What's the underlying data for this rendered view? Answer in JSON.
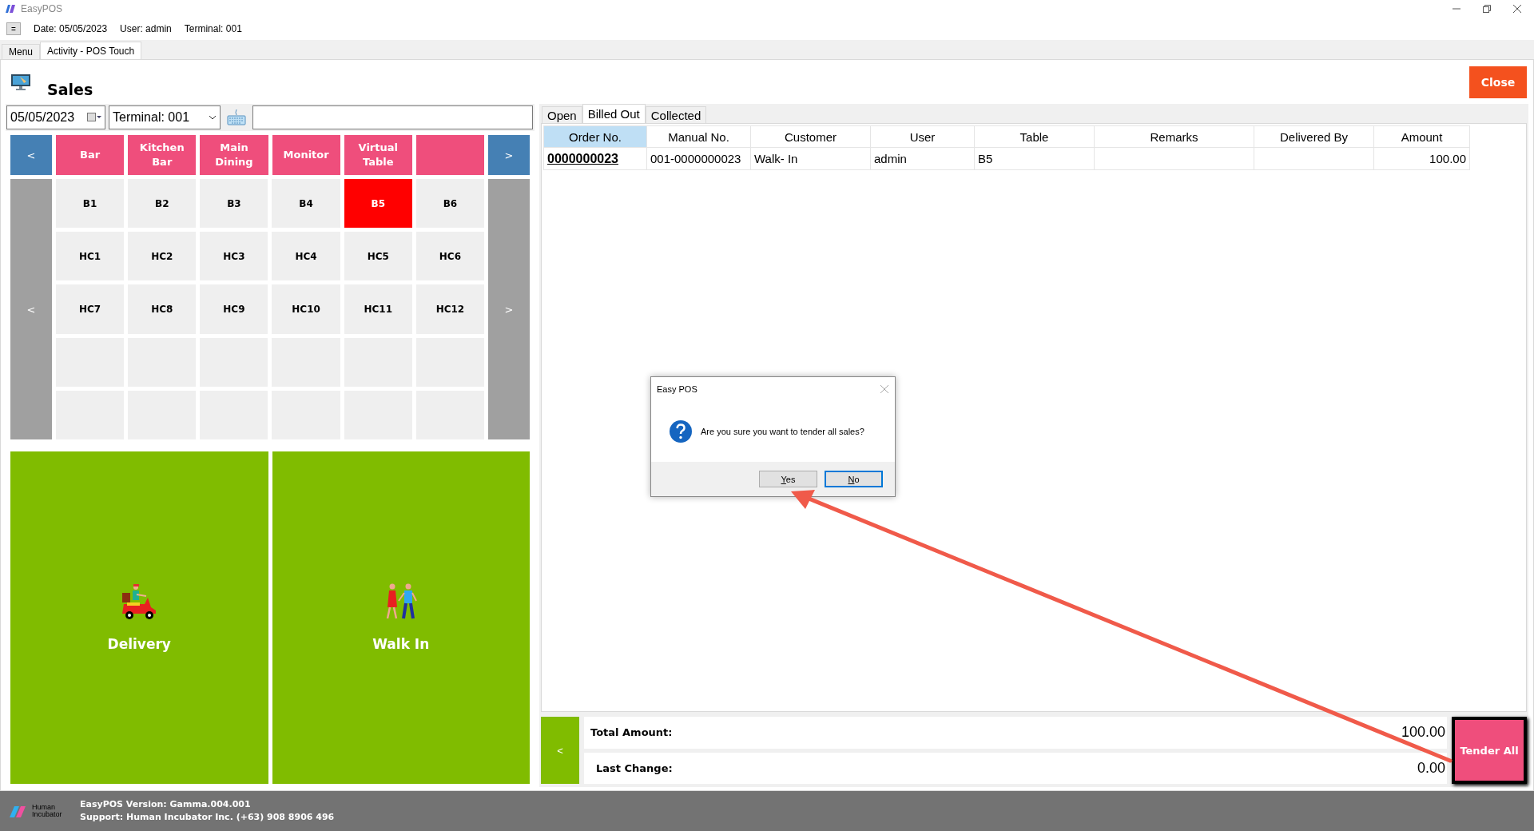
{
  "window": {
    "title": "EasyPOS"
  },
  "info_bar": {
    "menu_button": "=",
    "date": "Date: 05/05/2023",
    "user": "User: admin",
    "terminal": "Terminal: 001"
  },
  "tabs": [
    {
      "label": "Menu",
      "selected": false
    },
    {
      "label": "Activity - POS Touch",
      "selected": true
    }
  ],
  "page": {
    "title": "Sales",
    "close_button": "Close"
  },
  "filters": {
    "date": "05/05/2023",
    "terminal": "Terminal: 001"
  },
  "categories": {
    "prev": "<",
    "next": ">",
    "items": [
      {
        "kind": "category",
        "label": "Bar"
      },
      {
        "kind": "category",
        "label": "Kitchen Bar"
      },
      {
        "kind": "category",
        "label": "Main Dining"
      },
      {
        "kind": "category",
        "label": "Monitor"
      },
      {
        "kind": "category",
        "label": "Virtual Table"
      },
      {
        "kind": "blank"
      }
    ]
  },
  "tables": {
    "prev": "<",
    "next": ">",
    "items": [
      {
        "kind": "table",
        "label": "B1",
        "selected": false
      },
      {
        "kind": "table",
        "label": "B2",
        "selected": false
      },
      {
        "kind": "table",
        "label": "B3",
        "selected": false
      },
      {
        "kind": "table",
        "label": "B4",
        "selected": false
      },
      {
        "kind": "table",
        "label": "B5",
        "selected": true
      },
      {
        "kind": "table",
        "label": "B6",
        "selected": false
      },
      {
        "kind": "table",
        "label": "HC1",
        "selected": false
      },
      {
        "kind": "table",
        "label": "HC2",
        "selected": false
      },
      {
        "kind": "table",
        "label": "HC3",
        "selected": false
      },
      {
        "kind": "table",
        "label": "HC4",
        "selected": false
      },
      {
        "kind": "table",
        "label": "HC5",
        "selected": false
      },
      {
        "kind": "table",
        "label": "HC6",
        "selected": false
      },
      {
        "kind": "table",
        "label": "HC7",
        "selected": false
      },
      {
        "kind": "table",
        "label": "HC8",
        "selected": false
      },
      {
        "kind": "table",
        "label": "HC9",
        "selected": false
      },
      {
        "kind": "table",
        "label": "HC10",
        "selected": false
      },
      {
        "kind": "table",
        "label": "HC11",
        "selected": false
      },
      {
        "kind": "table",
        "label": "HC12",
        "selected": false
      },
      {
        "kind": "blank"
      },
      {
        "kind": "blank"
      },
      {
        "kind": "blank"
      },
      {
        "kind": "blank"
      },
      {
        "kind": "blank"
      },
      {
        "kind": "blank"
      },
      {
        "kind": "blank"
      },
      {
        "kind": "blank"
      },
      {
        "kind": "blank"
      },
      {
        "kind": "blank"
      },
      {
        "kind": "blank"
      },
      {
        "kind": "blank"
      }
    ]
  },
  "order_types": [
    {
      "kind": "delivery",
      "label": "Delivery"
    },
    {
      "kind": "walk_in",
      "label": "Walk In"
    }
  ],
  "order_tabs": [
    {
      "label": "Open",
      "selected": false
    },
    {
      "label": "Billed Out",
      "selected": true
    },
    {
      "label": "Collected",
      "selected": false
    }
  ],
  "orders": {
    "columns": [
      {
        "label": "Order No.",
        "selected": true
      },
      {
        "label": "Manual No.",
        "selected": false
      },
      {
        "label": "Customer",
        "selected": false
      },
      {
        "label": "User",
        "selected": false
      },
      {
        "label": "Table",
        "selected": false
      },
      {
        "label": "Remarks",
        "selected": false
      },
      {
        "label": "Delivered By",
        "selected": false
      },
      {
        "label": "Amount",
        "selected": false
      }
    ],
    "rows": [
      {
        "order_no": "0000000023",
        "manual_no": "001-0000000023",
        "customer": "Walk- In",
        "user": "admin",
        "table": "B5",
        "amount": "100.00"
      }
    ]
  },
  "summary": {
    "back_button": "<",
    "total_label": "Total Amount:",
    "total": "100.00",
    "change_label": "Last Change:",
    "change": "0.00",
    "tender_button": "Tender All"
  },
  "dialog": {
    "title": "Easy POS",
    "message": "Are you sure you want to tender all sales?",
    "buttons": [
      {
        "label": "Yes",
        "focused": false
      },
      {
        "label": "No",
        "focused": true
      }
    ]
  },
  "footer": {
    "logo_text": "Human Incubator",
    "version": "EasyPOS Version: Gamma.004.001",
    "support": "Support: Human Incubator Inc. (+63) 908 8906 496"
  }
}
